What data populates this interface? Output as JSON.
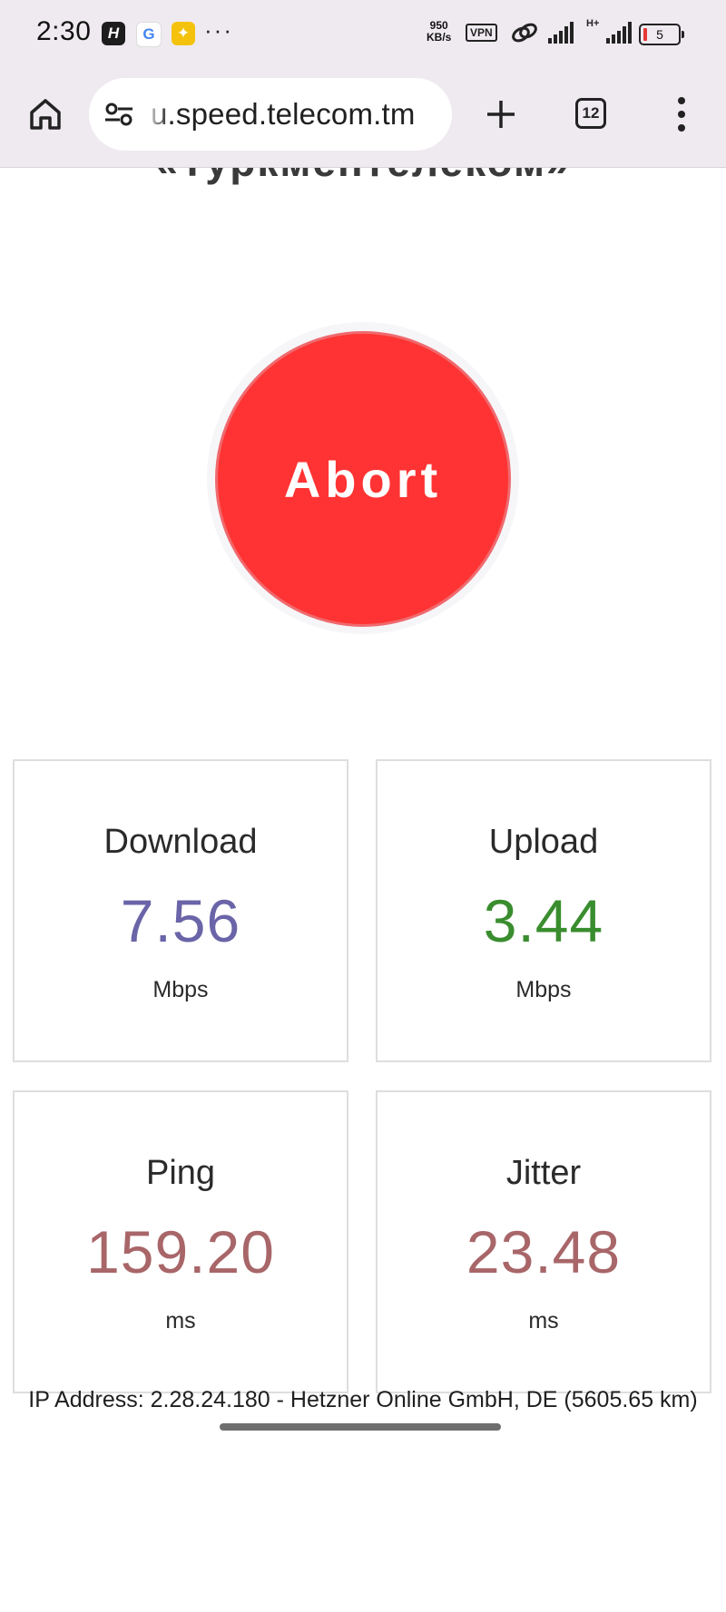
{
  "status_bar": {
    "time": "2:30",
    "app_icons": [
      "H",
      "G",
      "✦"
    ],
    "overflow": "···",
    "network_speed_value": "950",
    "network_speed_unit": "KB/s",
    "vpn_label": "VPN",
    "network_type": "H+",
    "battery_level": "5"
  },
  "browser": {
    "url": "u.speed.telecom.tm",
    "tab_count": "12",
    "icons": {
      "home": "home-icon",
      "site_settings": "tune-icon",
      "new_tab": "plus-icon",
      "tabs": "tab-switcher-icon",
      "menu": "more-vert-icon"
    }
  },
  "page": {
    "partial_title": "«Туркментелеком»",
    "abort_label": "Abort",
    "metrics": [
      {
        "label": "Download",
        "value": "7.56",
        "unit": "Mbps",
        "color": "#6a64a8"
      },
      {
        "label": "Upload",
        "value": "3.44",
        "unit": "Mbps",
        "color": "#3a8d2e"
      },
      {
        "label": "Ping",
        "value": "159.20",
        "unit": "ms",
        "color": "#a86669"
      },
      {
        "label": "Jitter",
        "value": "23.48",
        "unit": "ms",
        "color": "#a86669"
      }
    ],
    "ip_info": "IP Address: 2.28.24.180 - Hetzner Online GmbH, DE (5605.65 km)"
  },
  "colors": {
    "abort_button": "#ff3333",
    "browser_chrome": "#efeaf0"
  }
}
